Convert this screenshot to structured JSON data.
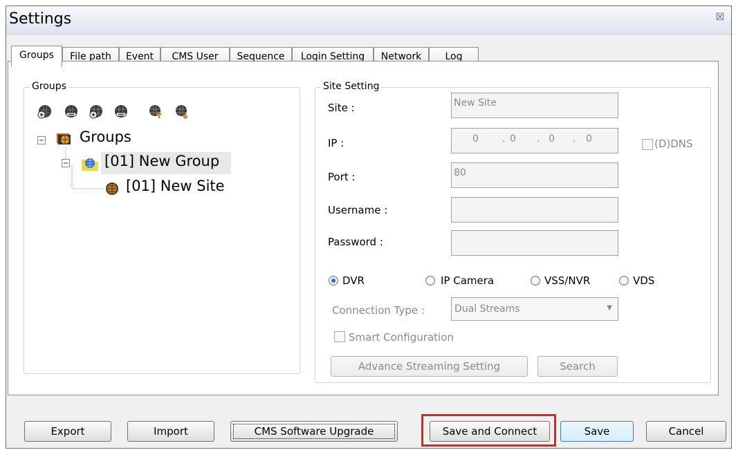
{
  "window": {
    "title": "Settings",
    "close_glyph": "☒"
  },
  "tabs": [
    {
      "label": "Groups",
      "active": true
    },
    {
      "label": "File path"
    },
    {
      "label": "Event"
    },
    {
      "label": "CMS User"
    },
    {
      "label": "Sequence"
    },
    {
      "label": "Login Setting"
    },
    {
      "label": "Network"
    },
    {
      "label": "Log"
    }
  ],
  "groups_panel": {
    "label": "Groups",
    "toolbar_icons": [
      "add-group-icon",
      "remove-group-icon",
      "add-site-icon",
      "remove-site-icon",
      "move-site-up-icon",
      "move-site-down-icon"
    ],
    "tree": {
      "root": "Groups",
      "group": "[01] New Group",
      "site": "[01] New Site"
    }
  },
  "site_setting": {
    "label": "Site Setting",
    "site_label": "Site :",
    "site_value": "New Site",
    "ip_label": "IP :",
    "ip_octets": [
      "0",
      "0",
      "0",
      "0"
    ],
    "ddns_label": "(D)DNS",
    "port_label": "Port :",
    "port_value": "80",
    "username_label": "Username :",
    "username_value": "",
    "password_label": "Password :",
    "password_value": "",
    "device_types": [
      {
        "label": "DVR",
        "selected": true
      },
      {
        "label": "IP Camera",
        "selected": false
      },
      {
        "label": "VSS/NVR",
        "selected": false
      },
      {
        "label": "VDS",
        "selected": false
      }
    ],
    "connection_type_label": "Connection Type :",
    "connection_type_value": "Dual Streams",
    "smart_config_label": "Smart Configuration",
    "advance_button": "Advance Streaming Setting",
    "search_button": "Search"
  },
  "footer": {
    "export": "Export",
    "import": "Import",
    "upgrade": "CMS Software Upgrade",
    "save_connect": "Save and Connect",
    "save": "Save",
    "cancel": "Cancel"
  },
  "colors": {
    "highlight_box": "#e8201d",
    "accent_radio": "#2a6cd1"
  }
}
